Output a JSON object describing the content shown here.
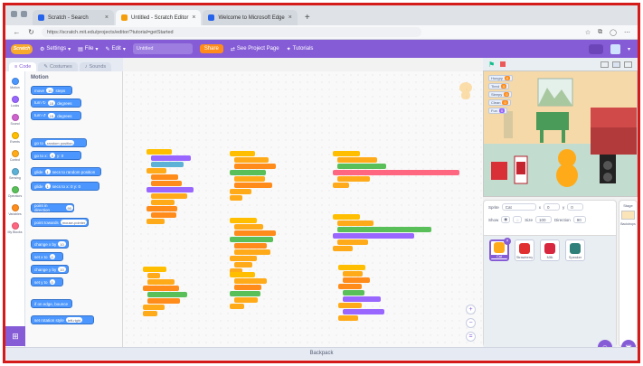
{
  "browser": {
    "tabs": [
      {
        "label": "Scratch - Search",
        "active": false
      },
      {
        "label": "Untitled - Scratch Editor",
        "active": true
      },
      {
        "label": "Welcome to Microsoft Edge",
        "active": false
      }
    ],
    "new_tab_symbol": "+",
    "url": "https://scratch.mit.edu/projects/editor/?tutorial=getStarted"
  },
  "menubar": {
    "logo": "Scratch",
    "settings_label": "Settings",
    "file_label": "File",
    "edit_label": "Edit",
    "project_title": "Untitled",
    "share_label": "Share",
    "see_project_page_label": "See Project Page",
    "tutorials_label": "Tutorials"
  },
  "editor_tabs": {
    "code_label": "Code",
    "costumes_label": "Costumes",
    "sounds_label": "Sounds"
  },
  "categories": [
    {
      "label": "Motion",
      "color": "#4c97ff"
    },
    {
      "label": "Looks",
      "color": "#9966ff"
    },
    {
      "label": "Sound",
      "color": "#cf63cf"
    },
    {
      "label": "Events",
      "color": "#ffbf00"
    },
    {
      "label": "Control",
      "color": "#ffab19"
    },
    {
      "label": "Sensing",
      "color": "#5cb1d6"
    },
    {
      "label": "Operators",
      "color": "#59c059"
    },
    {
      "label": "Variables",
      "color": "#ff8c1a"
    },
    {
      "label": "My Blocks",
      "color": "#ff6680"
    }
  ],
  "palette": {
    "section_title": "Motion",
    "blocks": [
      {
        "text": "move",
        "input": "10",
        "suffix": "steps"
      },
      {
        "text": "turn ↻",
        "input": "15",
        "suffix": "degrees"
      },
      {
        "text": "turn ↺",
        "input": "15",
        "suffix": "degrees"
      },
      {
        "text": "go to",
        "input": "random position",
        "suffix": ""
      },
      {
        "text": "go to x:",
        "input": "0",
        "suffix": "y: 0"
      },
      {
        "text": "glide",
        "input": "1",
        "suffix": "secs to random position"
      },
      {
        "text": "glide",
        "input": "1",
        "suffix": "secs to x: 0 y: 0"
      },
      {
        "text": "point in direction",
        "input": "90",
        "suffix": ""
      },
      {
        "text": "point towards",
        "input": "mouse-pointer",
        "suffix": ""
      },
      {
        "text": "change x by",
        "input": "10",
        "suffix": ""
      },
      {
        "text": "set x to",
        "input": "0",
        "suffix": ""
      },
      {
        "text": "change y by",
        "input": "10",
        "suffix": ""
      },
      {
        "text": "set y to",
        "input": "0",
        "suffix": ""
      },
      {
        "text": "if on edge, bounce",
        "input": "",
        "suffix": ""
      },
      {
        "text": "set rotation style",
        "input": "left-right",
        "suffix": ""
      }
    ]
  },
  "stage": {
    "monitors": [
      {
        "label": "Hungry",
        "value": "0",
        "kind": "orange"
      },
      {
        "label": "Tired",
        "value": "0",
        "kind": "orange"
      },
      {
        "label": "Sleepy",
        "value": "0",
        "kind": "orange"
      },
      {
        "label": "Clean",
        "value": "0",
        "kind": "orange"
      },
      {
        "label": "Fun",
        "value": "0",
        "kind": "purple"
      }
    ]
  },
  "sprite_info": {
    "sprite_label": "Sprite",
    "sprite_name": "Cat",
    "x_label": "x",
    "x_value": "0",
    "y_label": "y",
    "y_value": "0",
    "show_label": "Show",
    "size_label": "Size",
    "size_value": "100",
    "direction_label": "Direction",
    "direction_value": "90",
    "sprites": [
      {
        "name": "Cat",
        "color": "#ffab19",
        "selected": true
      },
      {
        "name": "Strawberry",
        "color": "#e0302f",
        "selected": false
      },
      {
        "name": "Milk",
        "color": "#d7263d",
        "selected": false
      },
      {
        "name": "Speaker",
        "color": "#2f7f7a",
        "selected": false
      }
    ],
    "delete_symbol": "×"
  },
  "stage_pane": {
    "label": "Stage",
    "backdrops_label": "Backdrops"
  },
  "footer": {
    "backpack_label": "Backpack"
  },
  "zoom": {
    "zoom_in": "+",
    "zoom_out": "−",
    "reset": "="
  }
}
